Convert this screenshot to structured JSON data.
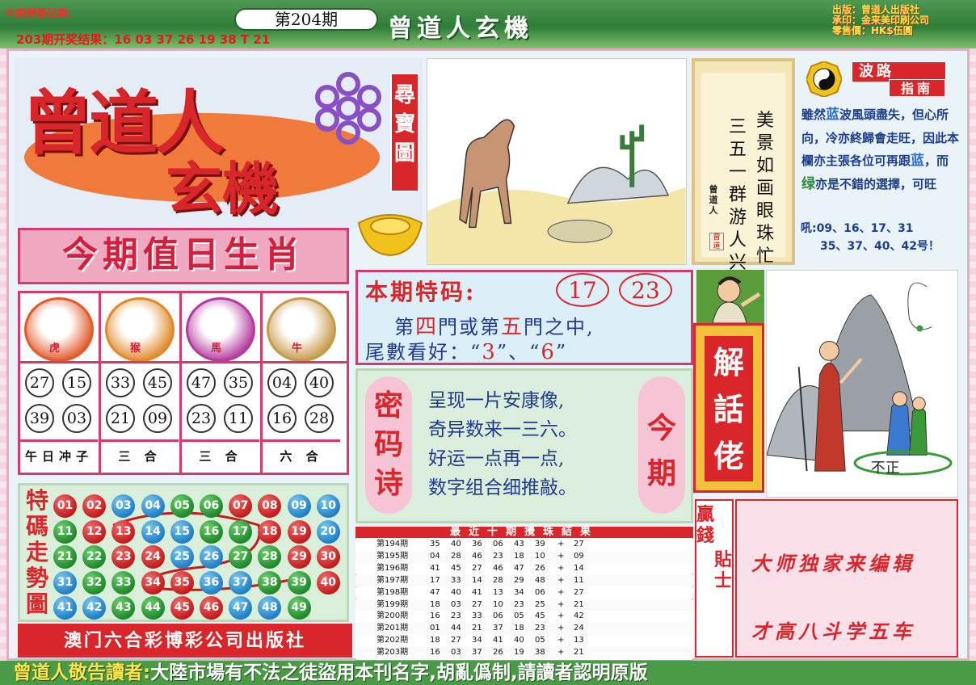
{
  "header": {
    "draw_date_label": "今期開獎日期:",
    "previous_result": "203期开奖结果：16 03 37 26 19 38 T 21",
    "issue": "第204期",
    "banner_title": "曾道人玄機",
    "publisher_lines": [
      "出版：曾道人出版社",
      "承印：金来美印刷公司",
      "零售價：HK$伍圓"
    ]
  },
  "logo": {
    "line1": "曾道人",
    "line2": "玄機",
    "treasure_tag": "尋寶圖"
  },
  "poem": {
    "col_right": "美景如画眼珠忙",
    "col_left": "三五一群游人兴",
    "signature": "曾道人",
    "seal": "曾道"
  },
  "wave_guide": {
    "title_1": "波路",
    "title_2": "指南",
    "text_1": "雖然",
    "word_blue": "蓝",
    "text_2": "波風頭盡失，但心所向，冷亦終歸會走旺，因此本欄亦主張各位可再跟",
    "word_blue_2": "蓝",
    "text_3": "，而",
    "word_green": "绿",
    "text_4": "亦是不錯的選擇，可旺",
    "numbers_line1": "吼:09、16、17、31",
    "numbers_line2": "35、37、40、42号！"
  },
  "zodiac": {
    "title": "今期值日生肖",
    "animals": [
      {
        "label": "虎",
        "numbers": [
          "27",
          "15",
          "39",
          "03"
        ],
        "footer": "午日冲子",
        "color": "#e25a2a"
      },
      {
        "label": "猴",
        "numbers": [
          "33",
          "45",
          "21",
          "09"
        ],
        "footer": "三 合",
        "color": "#e1892a"
      },
      {
        "label": "馬",
        "numbers": [
          "47",
          "35",
          "23",
          "11"
        ],
        "footer": "三 合",
        "color": "#b43a9e"
      },
      {
        "label": "牛",
        "numbers": [
          "04",
          "40",
          "16",
          "28"
        ],
        "footer": "六 合",
        "color": "#c69a4a"
      }
    ]
  },
  "trend": {
    "title": "特碼走勢圖",
    "balls": [
      [
        "01",
        "red"
      ],
      [
        "02",
        "red"
      ],
      [
        "03",
        "blue"
      ],
      [
        "04",
        "blue"
      ],
      [
        "05",
        "green"
      ],
      [
        "06",
        "green"
      ],
      [
        "07",
        "red"
      ],
      [
        "08",
        "red"
      ],
      [
        "09",
        "blue"
      ],
      [
        "10",
        "blue"
      ],
      [
        "11",
        "green"
      ],
      [
        "12",
        "red"
      ],
      [
        "13",
        "red"
      ],
      [
        "14",
        "blue"
      ],
      [
        "15",
        "blue"
      ],
      [
        "16",
        "green"
      ],
      [
        "17",
        "green"
      ],
      [
        "18",
        "red"
      ],
      [
        "19",
        "red"
      ],
      [
        "20",
        "blue"
      ],
      [
        "21",
        "green"
      ],
      [
        "22",
        "green"
      ],
      [
        "23",
        "red"
      ],
      [
        "24",
        "red"
      ],
      [
        "25",
        "blue"
      ],
      [
        "26",
        "blue"
      ],
      [
        "27",
        "green"
      ],
      [
        "28",
        "green"
      ],
      [
        "29",
        "red"
      ],
      [
        "30",
        "red"
      ],
      [
        "31",
        "blue"
      ],
      [
        "32",
        "green"
      ],
      [
        "33",
        "green"
      ],
      [
        "34",
        "red"
      ],
      [
        "35",
        "red"
      ],
      [
        "36",
        "blue"
      ],
      [
        "37",
        "blue"
      ],
      [
        "38",
        "green"
      ],
      [
        "39",
        "green"
      ],
      [
        "40",
        "red"
      ],
      [
        "41",
        "blue"
      ],
      [
        "42",
        "blue"
      ],
      [
        "43",
        "green"
      ],
      [
        "44",
        "green"
      ],
      [
        "45",
        "red"
      ],
      [
        "46",
        "red"
      ],
      [
        "47",
        "blue"
      ],
      [
        "48",
        "blue"
      ],
      [
        "49",
        "green"
      ]
    ]
  },
  "footer_left": "澳门六合彩博彩公司出版社",
  "special": {
    "title": "本期特码:",
    "num1": "17",
    "num2": "23",
    "line1_a": "第",
    "line1_b": "四",
    "line1_c": "門或第",
    "line1_d": "五",
    "line1_e": "門之中,",
    "line2_a": "尾數看好：“",
    "line2_b": "3",
    "line2_c": "”、“",
    "line2_d": "6",
    "line2_e": "”"
  },
  "secret_poem": {
    "left_tag": "密码诗",
    "right_tag": "今期",
    "lines": [
      "呈现一片安康像,",
      "奇异数来一三六。",
      "好运一点再一点,",
      "数字组合细推敲。"
    ]
  },
  "results": {
    "title": "最近十期攪珠結果",
    "rows": [
      {
        "issue": "第194期",
        "nums": [
          "35",
          "40",
          "36",
          "06",
          "43",
          "39"
        ],
        "plus": "+",
        "special": "27"
      },
      {
        "issue": "第195期",
        "nums": [
          "04",
          "28",
          "46",
          "23",
          "18",
          "10"
        ],
        "plus": "+",
        "special": "09"
      },
      {
        "issue": "第196期",
        "nums": [
          "41",
          "45",
          "27",
          "46",
          "47",
          "26"
        ],
        "plus": "+",
        "special": "14"
      },
      {
        "issue": "第197期",
        "nums": [
          "17",
          "33",
          "14",
          "28",
          "29",
          "48"
        ],
        "plus": "+",
        "special": "11"
      },
      {
        "issue": "第198期",
        "nums": [
          "47",
          "40",
          "41",
          "13",
          "34",
          "06"
        ],
        "plus": "+",
        "special": "27"
      },
      {
        "issue": "第199期",
        "nums": [
          "18",
          "03",
          "27",
          "10",
          "23",
          "25"
        ],
        "plus": "+",
        "special": "21"
      },
      {
        "issue": "第200期",
        "nums": [
          "16",
          "23",
          "33",
          "06",
          "05",
          "45"
        ],
        "plus": "+",
        "special": "42"
      },
      {
        "issue": "第201期",
        "nums": [
          "01",
          "44",
          "21",
          "37",
          "18",
          "23"
        ],
        "plus": "+",
        "special": "24"
      },
      {
        "issue": "第202期",
        "nums": [
          "18",
          "27",
          "34",
          "41",
          "40",
          "05"
        ],
        "plus": "+",
        "special": "13"
      },
      {
        "issue": "第203期",
        "nums": [
          "16",
          "03",
          "37",
          "26",
          "19",
          "38"
        ],
        "plus": "+",
        "special": "21"
      }
    ]
  },
  "jiehua": {
    "title": "解話佬",
    "scene_text": "不正"
  },
  "tips": {
    "label_1": "贏錢",
    "label_2": "貼士",
    "line_1": "大师独家来编辑",
    "line_2": "才高八斗学五车"
  },
  "bottom_notice": {
    "part_1": "曾道人敬告讀者:",
    "part_2": "大陸市場有不法之徒盜用本刊名字,胡亂僞制,請讀者認明原版"
  },
  "colors": {
    "red": "#d8262a",
    "green": "#1f8a2a",
    "blue": "#1f7fc7",
    "pink": "#f6c9d6"
  }
}
